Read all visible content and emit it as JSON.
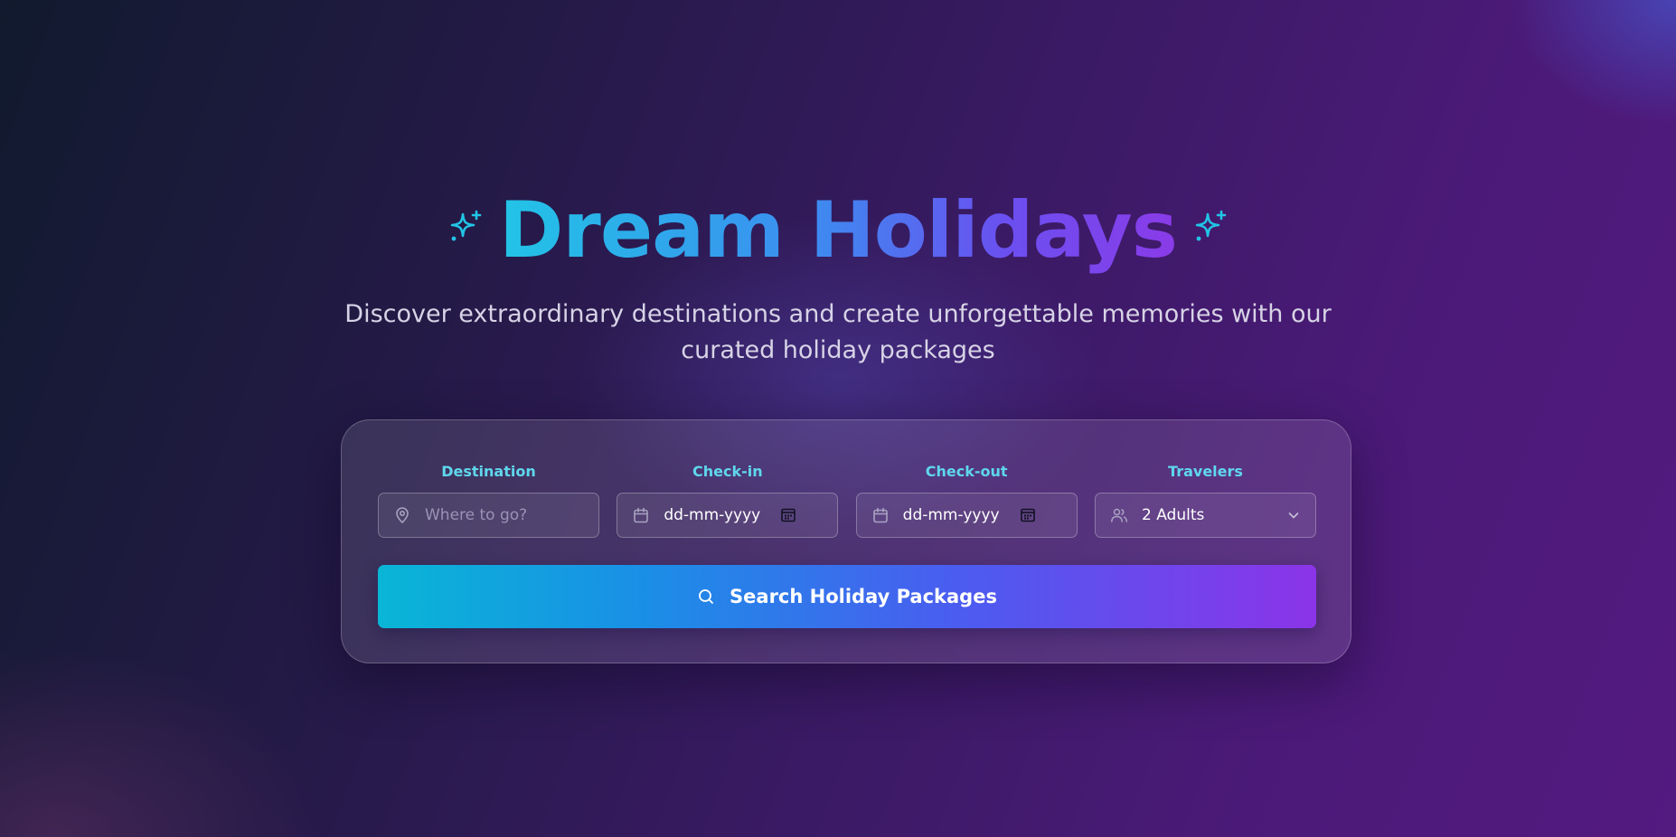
{
  "hero": {
    "title": "Dream Holidays",
    "subtitle": "Discover extraordinary destinations and create unforgettable memories with our curated holiday packages"
  },
  "search_form": {
    "destination": {
      "label": "Destination",
      "placeholder": "Where to go?",
      "icon": "map-pin-icon"
    },
    "check_in": {
      "label": "Check-in",
      "value": "dd-mm-yyyy",
      "icon": "calendar-icon"
    },
    "check_out": {
      "label": "Check-out",
      "value": "dd-mm-yyyy",
      "icon": "calendar-icon"
    },
    "travelers": {
      "label": "Travelers",
      "selected": "2 Adults",
      "icon": "users-icon"
    },
    "submit": {
      "label": "Search Holiday Packages",
      "icon": "search-icon"
    }
  },
  "colors": {
    "accent_label": "#5fd7ec",
    "title_gradient_start": "#22c4e6",
    "title_gradient_end": "#8a3be8",
    "button_gradient_start": "#09b6d6",
    "button_gradient_end": "#8b34e8"
  }
}
